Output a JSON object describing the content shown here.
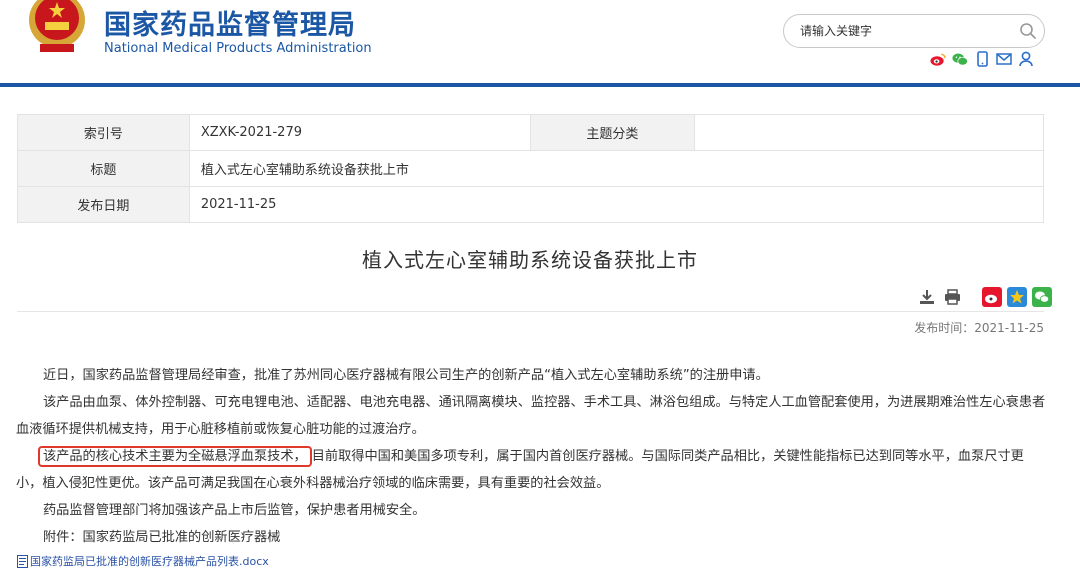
{
  "header": {
    "title_cn": "国家药品监督管理局",
    "title_en": "National Medical Products Administration",
    "search_placeholder": "请输入关键字",
    "social_icons": [
      "weibo-icon",
      "wechat-icon",
      "mobile-icon",
      "mail-icon",
      "user-icon"
    ]
  },
  "info": {
    "index_label": "索引号",
    "index_value": "XZXK-2021-279",
    "category_label": "主题分类",
    "category_value": "",
    "title_label": "标题",
    "title_value": "植入式左心室辅助系统设备获批上市",
    "date_label": "发布日期",
    "date_value": "2021-11-25"
  },
  "article": {
    "title": "植入式左心室辅助系统设备获批上市",
    "pubdate": "发布时间：2021-11-25",
    "p1": "近日，国家药品监督管理局经审查，批准了苏州同心医疗器械有限公司生产的创新产品“植入式左心室辅助系统”的注册申请。",
    "p2": "该产品由血泵、体外控制器、可充电锂电池、适配器、电池充电器、通讯隔离模块、监控器、手术工具、淋浴包组成。与特定人工血管配套使用，为进展期难治性左心衰患者血液循环提供机械支持，用于心脏移植前或恢复心脏功能的过渡治疗。",
    "p3_highlight": "该产品的核心技术主要为全磁悬浮血泵技术，",
    "p3_rest": "目前取得中国和美国多项专利，属于国内首创医疗器械。与国际同类产品相比，关键性能指标已达到同等水平，血泵尺寸更小，植入侵犯性更优。该产品可满足我国在心衰外科器械治疗领域的临床需要，具有重要的社会效益。",
    "p4": "药品监督管理部门将加强该产品上市后监管，保护患者用械安全。",
    "p5": "附件：国家药监局已批准的创新医疗器械",
    "attachment": "国家药监局已批准的创新医疗器械产品列表.docx"
  },
  "colors": {
    "brand_blue": "#1b57a5",
    "highlight_red": "#e0392b"
  }
}
